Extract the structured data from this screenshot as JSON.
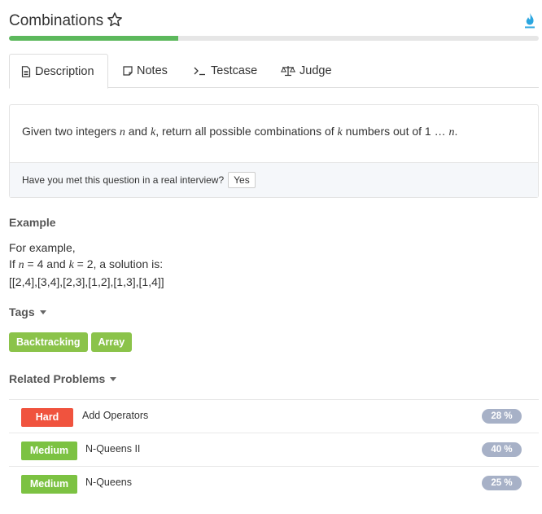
{
  "problem": {
    "title": "Combinations",
    "progress_percent": 32
  },
  "tabs": [
    {
      "label": "Description",
      "icon": "document-icon",
      "active": true
    },
    {
      "label": "Notes",
      "icon": "note-icon",
      "active": false
    },
    {
      "label": "Testcase",
      "icon": "terminal-icon",
      "active": false
    },
    {
      "label": "Judge",
      "icon": "scale-icon",
      "active": false
    }
  ],
  "description": {
    "text_before_n": "Given two integers ",
    "var_n": "n",
    "text_and": " and ",
    "var_k": "k",
    "text_middle": ", return all possible combinations of ",
    "var_k2": "k",
    "text_end": " numbers out of 1 … ",
    "var_n2": "n",
    "text_period": "."
  },
  "interview": {
    "question": "Have you met this question in a real interview?",
    "yes_label": "Yes"
  },
  "example": {
    "heading": "Example",
    "line1": "For example,",
    "line2_prefix": "If ",
    "line2_n": "n",
    "line2_mid1": " = 4 and ",
    "line2_k": "k",
    "line2_mid2": " = 2, a solution is:",
    "line3": "[[2,4],[3,4],[2,3],[1,2],[1,3],[1,4]]"
  },
  "tags": {
    "heading": "Tags",
    "items": [
      "Backtracking",
      "Array"
    ]
  },
  "related": {
    "heading": "Related Problems",
    "items": [
      {
        "difficulty": "Hard",
        "name": "Add Operators",
        "percent": "28 %"
      },
      {
        "difficulty": "Medium",
        "name": "N-Queens II",
        "percent": "40 %"
      },
      {
        "difficulty": "Medium",
        "name": "N-Queens",
        "percent": "25 %"
      }
    ]
  },
  "colors": {
    "progress": "#5cb85c",
    "tag": "#8bc34a",
    "hard": "#f0533e",
    "medium": "#7cc242",
    "percent_pill": "#a7b1c7",
    "flame": "#2ba6e0"
  }
}
